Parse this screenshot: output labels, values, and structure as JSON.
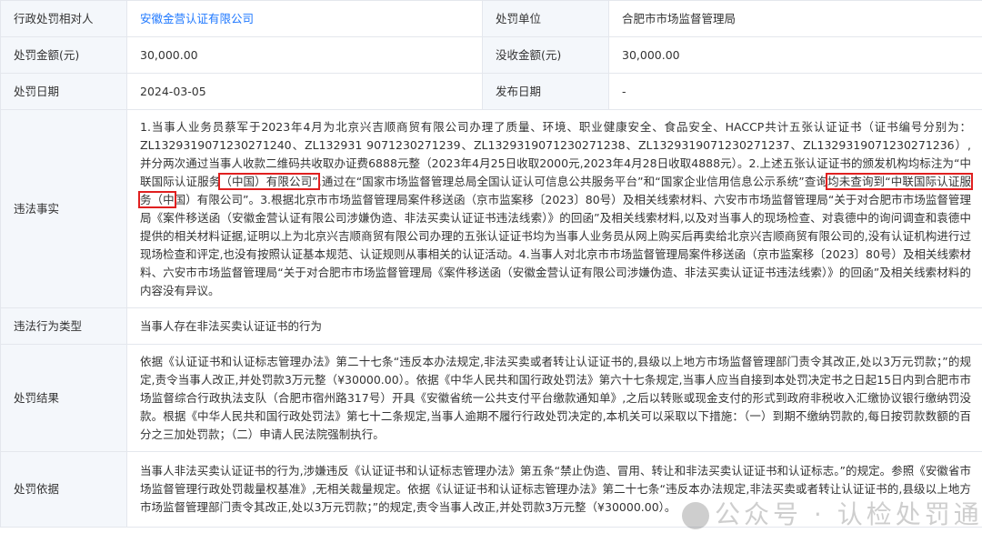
{
  "rows": {
    "r1": {
      "label_a": "行政处罚相对人",
      "value_a": "安徽金营认证有限公司",
      "label_b": "处罚单位",
      "value_b": "合肥市市场监督管理局"
    },
    "r2": {
      "label_a": "处罚金额(元)",
      "value_a": "30,000.00",
      "label_b": "没收金额(元)",
      "value_b": "30,000.00"
    },
    "r3": {
      "label_a": "处罚日期",
      "value_a": "2024-03-05",
      "label_b": "发布日期",
      "value_b": "-"
    },
    "facts": {
      "label": "违法事实",
      "text_1": "1.当事人业务员蔡军于2023年4月为北京兴吉顺商贸有限公司办理了质量、环境、职业健康安全、食品安全、HACCP共计五张认证证书（证书编号分别为：ZL1329319071230271240、ZL132931 9071230271239、ZL1329319071230271238、ZL1329319071230271237、ZL1329319071230271236）,并分两次通过当事人收款二维码共收取办证费6888元整（2023年4月25日收取2000元,2023年4月28日收取4888元）。2.上述五张认证证书的颁发机构均标注为“中联国际认证服务",
      "hl_1": "（中国）有限公司”",
      "text_2": ",通过在“国家市场监督管理总局全国认证认可信息公共服务平台”和“国家企业信用信息公示系统”查询",
      "hl_2": "均未查询到“中联国际认证服务（中",
      "text_3": "国）有限公司”。3.根据北京市市场监督管理局案件移送函（京市监案移〔2023〕80号）及相关线索材料、六安市市场监督管理局“关于对合肥市市场监督管理局《案件移送函（安徽金营认证有限公司涉嫌伪造、非法买卖认证证书违法线索）》的回函”及相关线索材料,以及对当事人的现场检查、对袁德中的询问调查和袁德中提供的相关材料证据,证明以上为北京兴吉顺商贸有限公司办理的五张认证证书均为当事人业务员从网上购买后再卖给北京兴吉顺商贸有限公司的,没有认证机构进行过现场检查和评定,也没有按照认证基本规范、认证规则从事相关的认证活动。4.当事人对北京市市场监督管理局案件移送函（京市监案移〔2023〕80号）及相关线索材料、六安市市场监督管理局“关于对合肥市市场监督管理局《案件移送函（安徽金营认证有限公司涉嫌伪造、非法买卖认证证书违法线索）》的回函”及相关线索材料的内容没有异议。"
    },
    "type": {
      "label": "违法行为类型",
      "value": "当事人存在非法买卖认证证书的行为"
    },
    "result": {
      "label": "处罚结果",
      "value": "依据《认证证书和认证标志管理办法》第二十七条“违反本办法规定,非法买卖或者转让认证证书的,县级以上地方市场监督管理部门责令其改正,处以3万元罚款；”的规定,责令当事人改正,并处罚款3万元整（¥30000.00）。依据《中华人民共和国行政处罚法》第六十七条规定,当事人应当自接到本处罚决定书之日起15日内到合肥市市场监督综合行政执法支队（合肥市宿州路317号）开具《安徽省统一公共支付平台缴款通知单》,之后以转账或现金支付的形式到政府非税收入汇缴协议银行缴纳罚没款。根据《中华人民共和国行政处罚法》第七十二条规定,当事人逾期不履行行政处罚决定的,本机关可以采取以下措施：（一）到期不缴纳罚款的,每日按罚款数额的百分之三加处罚款；（二）申请人民法院强制执行。"
    },
    "basis": {
      "label": "处罚依据",
      "value": "当事人非法买卖认证证书的行为,涉嫌违反《认证证书和认证标志管理办法》第五条“禁止伪造、冒用、转让和非法买卖认证证书和认证标志。”的规定。参照《安徽省市场监督管理行政处罚裁量权基准》,无相关裁量规定。依据《认证证书和认证标志管理办法》第二十七条“违反本办法规定,非法买卖或者转让认证证书的,县级以上地方市场监督管理部门责令其改正,处以3万元罚款；”的规定,责令当事人改正,并处罚款3万元整（¥30000.00）。"
    }
  },
  "watermark": {
    "text": "公众号 · 认检处罚通报",
    "icon": "wechat-icon"
  }
}
